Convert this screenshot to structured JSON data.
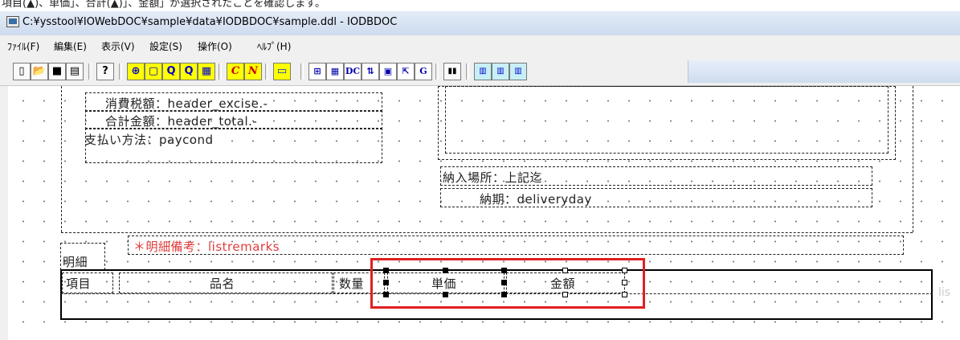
{
  "top_caption": "項目(▲)、単価」、合計(▲)」、金額」が選択されたことを確認します。",
  "window": {
    "title": "C:¥ysstool¥IOWebDOC¥sample¥data¥IODBDOC¥sample.ddl - IODBDOC"
  },
  "menu": [
    "ﾌｧｲﾙ(F)",
    "編集(E)",
    "表示(V)",
    "設定(S)",
    "操作(O)",
    "ﾍﾙﾌﾟ(H)"
  ],
  "toolbar": {
    "buttons": [
      {
        "icon": "new-icon",
        "glyph": "▯"
      },
      {
        "icon": "open-icon",
        "glyph": "📂"
      },
      {
        "icon": "save-icon",
        "glyph": "■"
      },
      {
        "icon": "page-icon",
        "glyph": "▤"
      },
      {
        "icon": "help-icon",
        "glyph": "?"
      },
      {
        "icon": "zoom-in-icon",
        "glyph": "⊕"
      },
      {
        "icon": "fit-page-icon",
        "glyph": "▢"
      },
      {
        "icon": "zoom-out-icon",
        "glyph": "Q"
      },
      {
        "icon": "zoom-reset-icon",
        "glyph": "Q"
      },
      {
        "icon": "grid-icon",
        "glyph": "▦"
      },
      {
        "icon": "c-mode-icon",
        "glyph": "C"
      },
      {
        "icon": "n-mode-icon",
        "glyph": "N"
      },
      {
        "icon": "field-icon",
        "glyph": "▭"
      },
      {
        "icon": "insert-field-icon",
        "glyph": "⊞"
      },
      {
        "icon": "table-icon",
        "glyph": "▦"
      },
      {
        "icon": "dc-icon",
        "glyph": "DC"
      },
      {
        "icon": "sort-icon",
        "glyph": "⇅"
      },
      {
        "icon": "form-icon",
        "glyph": "▣"
      },
      {
        "icon": "export-icon",
        "glyph": "⇱"
      },
      {
        "icon": "g-icon",
        "glyph": "G"
      },
      {
        "icon": "columns-icon",
        "glyph": "▮▮"
      },
      {
        "icon": "layout-1-icon",
        "glyph": "▥"
      },
      {
        "icon": "layout-2-icon",
        "glyph": "▥"
      },
      {
        "icon": "layout-3-icon",
        "glyph": "▥"
      }
    ]
  },
  "fields": {
    "excise": "消費税額：header_excise.-",
    "total": "合計金額：header_total.-",
    "paycond": "支払い方法：paycond",
    "delivery_place": "納入場所：上記迄",
    "delivery_day": "納期：deliveryday",
    "remarks": "＊明細備考：listremarks",
    "detail_label": "明細",
    "col_item": "項目",
    "col_name": "品名",
    "col_qty": "数量",
    "col_unit": "単価",
    "col_amount": "金額",
    "overflow_text": "lis"
  },
  "colors": {
    "remarks_text": "#e23b3b",
    "highlight": "#e02020"
  }
}
